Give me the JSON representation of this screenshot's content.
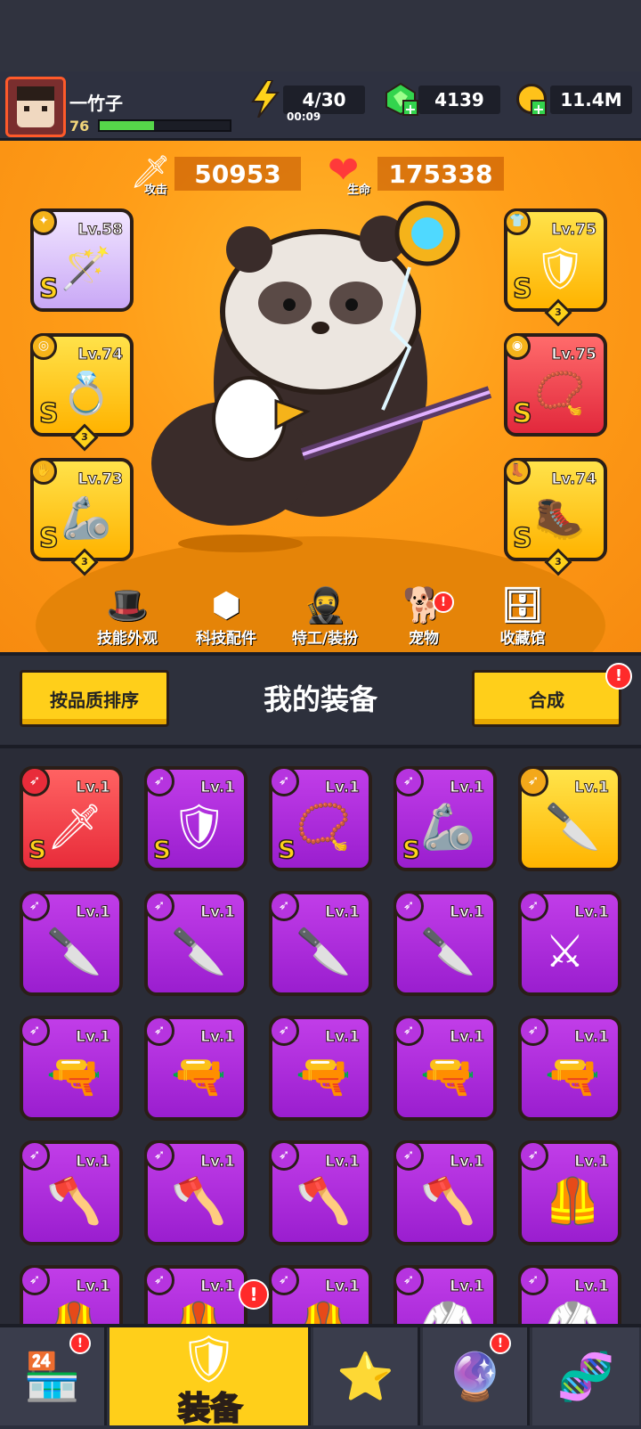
{
  "player": {
    "name": "一竹子",
    "level": "76",
    "xp_fraction": 0.42,
    "avatar_icon": "ninja-avatar-icon"
  },
  "resources": {
    "energy": "4/30",
    "energy_timer": "00:09",
    "gems": "4139",
    "coins": "11.4M"
  },
  "stats": {
    "attack_label": "攻击",
    "attack_value": "50953",
    "hp_label": "生命",
    "hp_value": "175338"
  },
  "equipped": [
    {
      "level": "Lv.58",
      "grade": "S",
      "stars": "",
      "icon": "✦",
      "art": "🪄",
      "color": "purple"
    },
    {
      "level": "Lv.74",
      "grade": "S",
      "stars": "3",
      "icon": "◎",
      "art": "💍",
      "color": "yellow"
    },
    {
      "level": "Lv.73",
      "grade": "S",
      "stars": "3",
      "icon": "✋",
      "art": "🦾",
      "color": "yellow"
    },
    {
      "level": "Lv.75",
      "grade": "S",
      "stars": "3",
      "icon": "👕",
      "art": "🛡",
      "color": "yellow"
    },
    {
      "level": "Lv.75",
      "grade": "S",
      "stars": "",
      "icon": "◉",
      "art": "📿",
      "color": "red"
    },
    {
      "level": "Lv.74",
      "grade": "S",
      "stars": "3",
      "icon": "👢",
      "art": "🥾",
      "color": "yellow"
    }
  ],
  "menu": [
    {
      "label": "技能外观",
      "icon": "🎩"
    },
    {
      "label": "科技配件",
      "icon": "⬢"
    },
    {
      "label": "特工/装扮",
      "icon": "🥷"
    },
    {
      "label": "宠物",
      "icon": "🐕"
    },
    {
      "label": "收藏馆",
      "icon": "🗄"
    }
  ],
  "inventory": {
    "sort_button": "按品质排序",
    "title": "我的装备",
    "merge_button": "合成",
    "items": [
      {
        "level": "Lv.1",
        "grade": "S",
        "color": "red",
        "art": "🗡"
      },
      {
        "level": "Lv.1",
        "grade": "S",
        "color": "purple",
        "art": "🛡"
      },
      {
        "level": "Lv.1",
        "grade": "S",
        "color": "purple",
        "art": "📿"
      },
      {
        "level": "Lv.1",
        "grade": "S",
        "color": "purple",
        "art": "🦾"
      },
      {
        "level": "Lv.1",
        "grade": "",
        "color": "yellow",
        "art": "🔪"
      },
      {
        "level": "Lv.1",
        "grade": "",
        "color": "purple",
        "art": "🔪"
      },
      {
        "level": "Lv.1",
        "grade": "",
        "color": "purple",
        "art": "🔪"
      },
      {
        "level": "Lv.1",
        "grade": "",
        "color": "purple",
        "art": "🔪"
      },
      {
        "level": "Lv.1",
        "grade": "",
        "color": "purple",
        "art": "🔪"
      },
      {
        "level": "Lv.1",
        "grade": "",
        "color": "purple",
        "art": "⚔"
      },
      {
        "level": "Lv.1",
        "grade": "",
        "color": "purple",
        "art": "🔫"
      },
      {
        "level": "Lv.1",
        "grade": "",
        "color": "purple",
        "art": "🔫"
      },
      {
        "level": "Lv.1",
        "grade": "",
        "color": "purple",
        "art": "🔫"
      },
      {
        "level": "Lv.1",
        "grade": "",
        "color": "purple",
        "art": "🔫"
      },
      {
        "level": "Lv.1",
        "grade": "",
        "color": "purple",
        "art": "🔫"
      },
      {
        "level": "Lv.1",
        "grade": "",
        "color": "purple",
        "art": "🪓"
      },
      {
        "level": "Lv.1",
        "grade": "",
        "color": "purple",
        "art": "🪓"
      },
      {
        "level": "Lv.1",
        "grade": "",
        "color": "purple",
        "art": "🪓"
      },
      {
        "level": "Lv.1",
        "grade": "",
        "color": "purple",
        "art": "🪓"
      },
      {
        "level": "Lv.1",
        "grade": "",
        "color": "purple",
        "art": "🦺"
      },
      {
        "level": "Lv.1",
        "grade": "",
        "color": "purple",
        "art": "🦺"
      },
      {
        "level": "Lv.1",
        "grade": "",
        "color": "purple",
        "art": "🦺"
      },
      {
        "level": "Lv.1",
        "grade": "",
        "color": "purple",
        "art": "🦺"
      },
      {
        "level": "Lv.1",
        "grade": "",
        "color": "purple",
        "art": "🥋"
      },
      {
        "level": "Lv.1",
        "grade": "",
        "color": "purple",
        "art": "🥋"
      }
    ]
  },
  "tabs": {
    "active_label": "装备"
  }
}
